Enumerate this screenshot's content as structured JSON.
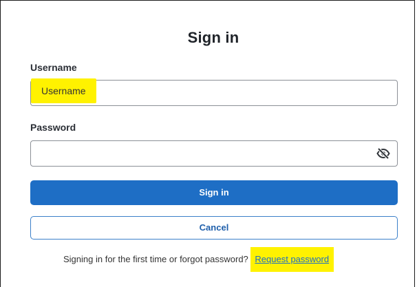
{
  "title": "Sign in",
  "username": {
    "label": "Username",
    "placeholder": "Username",
    "value": ""
  },
  "password": {
    "label": "Password",
    "value": "",
    "toggle_icon": "eye-off-icon"
  },
  "buttons": {
    "sign_in": "Sign in",
    "cancel": "Cancel"
  },
  "footer": {
    "text": "Signing in for the first time or forgot password?",
    "link": "Request password"
  },
  "colors": {
    "primary": "#1e6ec5",
    "highlight": "#fff200",
    "text": "#1f2329"
  }
}
